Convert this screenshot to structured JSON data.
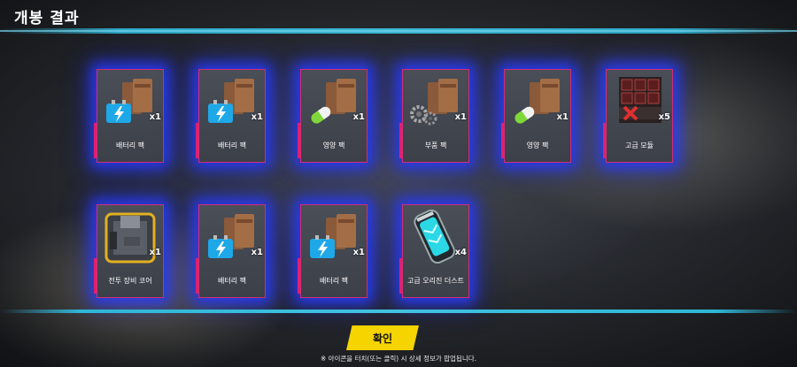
{
  "title": "개봉 결과",
  "confirm_label": "확인",
  "note": "※ 아이콘을 터치(또는 클릭) 시 상세 정보가 팝업됩니다.",
  "items": [
    {
      "label": "배터리 팩",
      "qty": "x1",
      "icon": "battery-pack-icon"
    },
    {
      "label": "배터리 팩",
      "qty": "x1",
      "icon": "battery-pack-icon"
    },
    {
      "label": "영양 팩",
      "qty": "x1",
      "icon": "nutrition-pack-icon"
    },
    {
      "label": "부품 팩",
      "qty": "x1",
      "icon": "parts-pack-icon"
    },
    {
      "label": "영양 팩",
      "qty": "x1",
      "icon": "nutrition-pack-icon"
    },
    {
      "label": "고급 모듈",
      "qty": "x5",
      "icon": "module-icon"
    },
    {
      "label": "전투 장비 코어",
      "qty": "x1",
      "icon": "combat-core-icon"
    },
    {
      "label": "배터리 팩",
      "qty": "x1",
      "icon": "battery-pack-icon"
    },
    {
      "label": "배터리 팩",
      "qty": "x1",
      "icon": "battery-pack-icon"
    },
    {
      "label": "고급 오리진 더스트",
      "qty": "x4",
      "icon": "origin-dust-icon"
    }
  ],
  "colors": {
    "accent_line": "#3cc8e6",
    "card_border": "#d12c7a",
    "glow": "#2a3cff",
    "button": "#f5d400"
  }
}
